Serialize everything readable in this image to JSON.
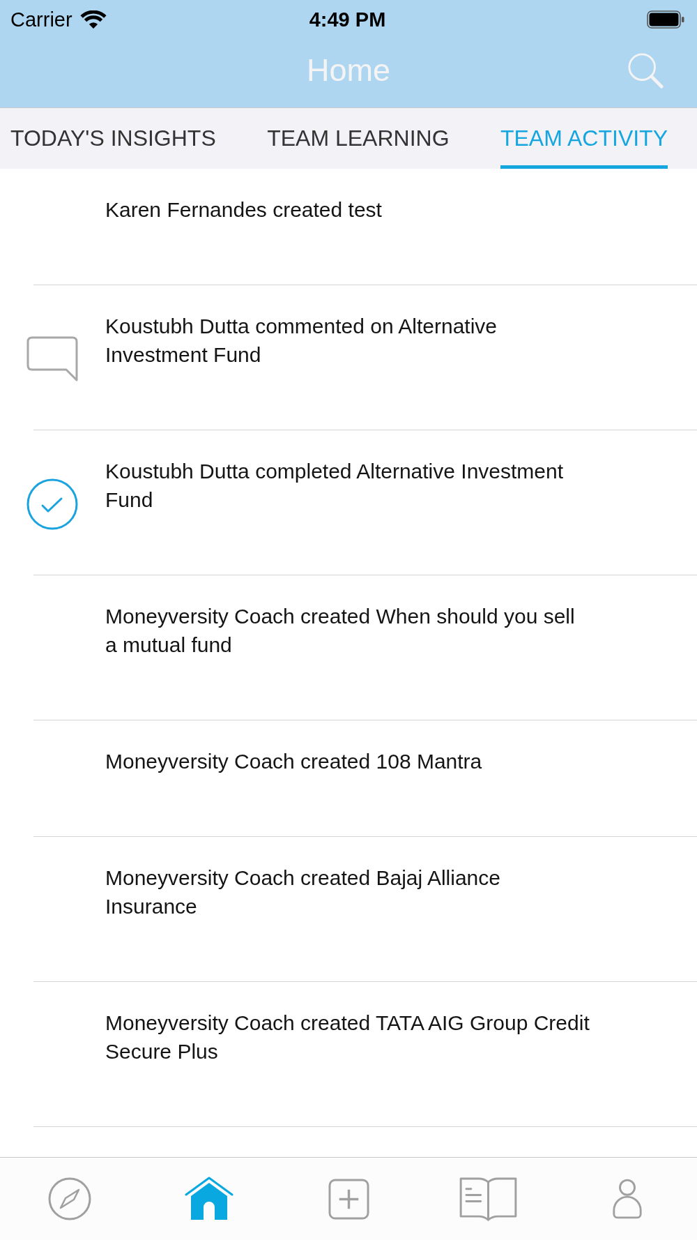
{
  "status_bar": {
    "carrier": "Carrier",
    "time": "4:49 PM"
  },
  "nav_bar": {
    "title": "Home"
  },
  "tabs": [
    {
      "label": "TODAY'S INSIGHTS",
      "selected": false
    },
    {
      "label": "TEAM LEARNING",
      "selected": false
    },
    {
      "label": "TEAM ACTIVITY",
      "selected": true
    }
  ],
  "activities": [
    {
      "kind": "created",
      "text": "Karen Fernandes created test"
    },
    {
      "kind": "comment",
      "text": "Koustubh Dutta commented on Alternative\nInvestment Fund"
    },
    {
      "kind": "completed",
      "text": "Koustubh Dutta completed Alternative Investment\nFund"
    },
    {
      "kind": "created",
      "text": "Moneyversity Coach created When should you sell\na mutual fund"
    },
    {
      "kind": "created",
      "text": "Moneyversity Coach created 108 Mantra"
    },
    {
      "kind": "created",
      "text": "Moneyversity Coach created Bajaj Alliance\nInsurance"
    },
    {
      "kind": "created",
      "text": "Moneyversity Coach created TATA AIG Group Credit\nSecure Plus"
    }
  ],
  "tab_bar": [
    {
      "kind": "explore",
      "selected": false
    },
    {
      "kind": "home",
      "selected": true
    },
    {
      "kind": "create",
      "selected": false
    },
    {
      "kind": "library",
      "selected": false
    },
    {
      "kind": "profile",
      "selected": false
    }
  ]
}
